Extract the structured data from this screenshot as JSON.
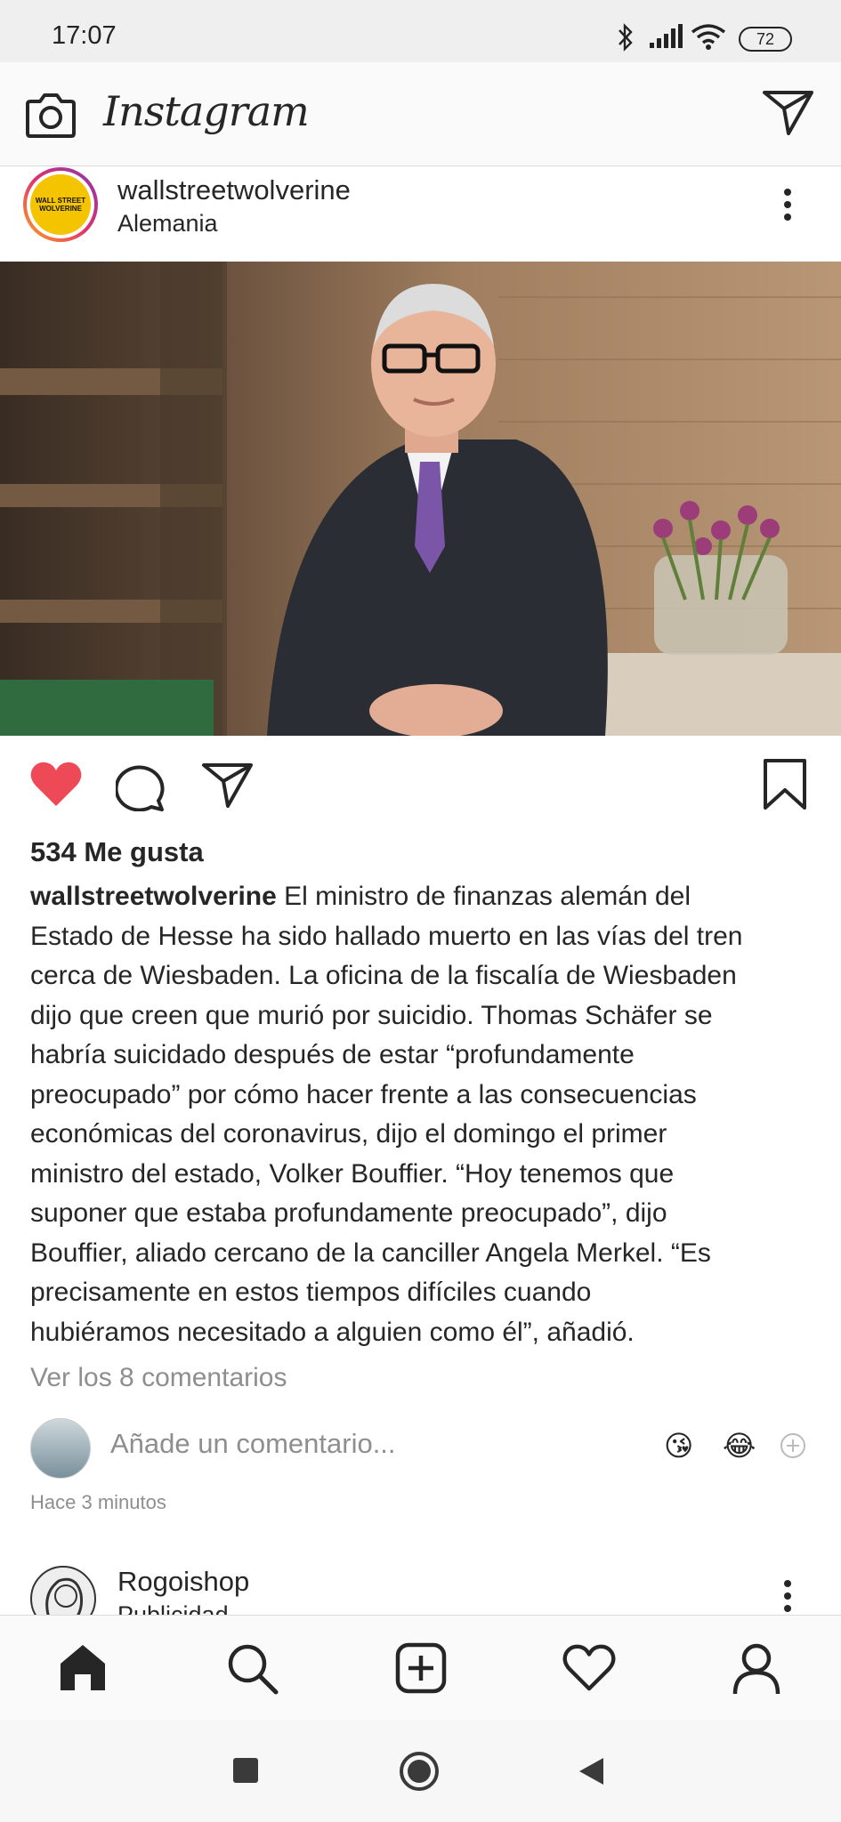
{
  "status_bar": {
    "time": "17:07",
    "battery": "72"
  },
  "header": {
    "app_name": "Instagram"
  },
  "post": {
    "avatar_text": "WALL STREET WOLVERINE",
    "username": "wallstreetwolverine",
    "location": "Alemania",
    "likes": "534 Me gusta",
    "caption_username": "wallstreetwolverine",
    "caption_lines": [
      " El ministro de finanzas alemán del",
      "Estado de Hesse ha sido hallado muerto en las vías del tren",
      "cerca de Wiesbaden. La oficina de la fiscalía de Wiesbaden",
      "dijo que creen que murió por suicidio. Thomas Schäfer se",
      "habría suicidado después de estar “profundamente",
      "preocupado” por cómo hacer frente a las consecuencias",
      "económicas del coronavirus, dijo el domingo el primer",
      "ministro del estado, Volker Bouffier. “Hoy tenemos que",
      "suponer que estaba profundamente preocupado”, dijo",
      "Bouffier, aliado cercano de la canciller Angela Merkel. “Es",
      "precisamente en estos tiempos difíciles cuando",
      "hubiéramos necesitado a alguien como él”, añadió."
    ],
    "view_comments": "Ver los 8 comentarios",
    "comment_placeholder": "Añade un comentario...",
    "emoji_1": "😘",
    "emoji_2": "😂",
    "timestamp": "Hace 3 minutos"
  },
  "next_post": {
    "username": "Rogoishop",
    "subtitle": "Publicidad"
  },
  "colors": {
    "like_red": "#ed4956",
    "muted_text": "#8e8e8e",
    "text": "#262626"
  },
  "icons": [
    "camera-icon",
    "direct-message-icon",
    "more-options-icon",
    "heart-icon",
    "comment-icon",
    "share-icon",
    "bookmark-icon",
    "home-icon",
    "search-icon",
    "add-post-icon",
    "activity-icon",
    "profile-icon",
    "bluetooth-icon",
    "signal-icon",
    "wifi-icon"
  ]
}
